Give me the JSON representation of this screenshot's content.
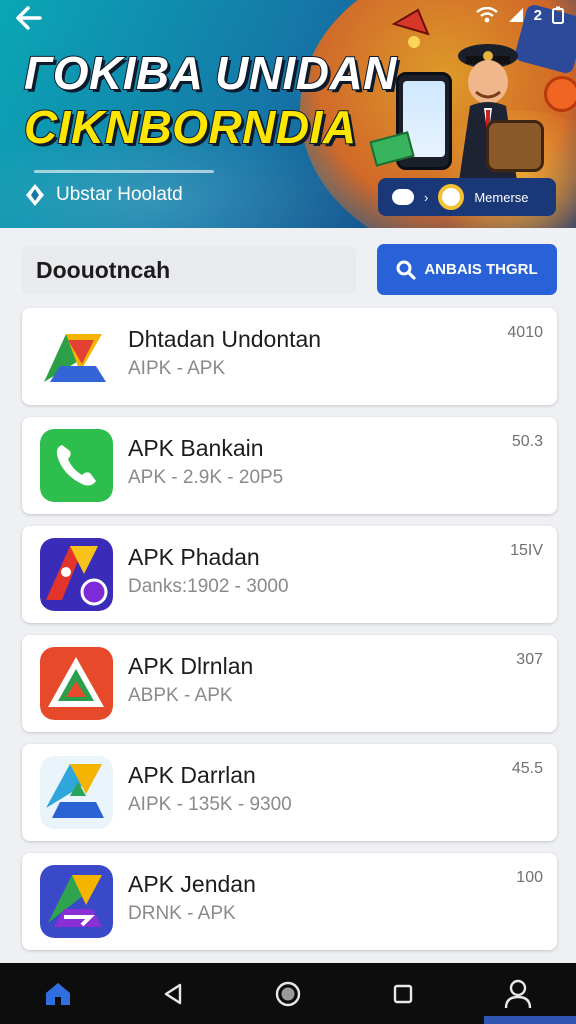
{
  "banner": {
    "title_line1": "ГOKIBA UNIDAN",
    "title_line2": "CIKNBORNDIA",
    "subtitle": "Ubstar Hoolatd",
    "pill_label": "Memerse",
    "pill_arrow": "›",
    "status": {
      "battery_text": "2"
    }
  },
  "section": {
    "title": "Doouotncah",
    "search_button_label": "ANBAIS THGRL"
  },
  "apps": [
    {
      "title": "Dhtadan Undontan",
      "meta": "AIPK - APK",
      "rating": "4010"
    },
    {
      "title": "APK Bankain",
      "meta": "APK - 2.9K - 20P5",
      "rating": "50.3"
    },
    {
      "title": "APK Phadan",
      "meta": "Danks:1902 - 3000",
      "rating": "15IV"
    },
    {
      "title": "APK Dlrnlan",
      "meta": "ABPK - APK",
      "rating": "307"
    },
    {
      "title": "APK Darrlan",
      "meta": "AIPK - 135K - 9300",
      "rating": "45.5"
    },
    {
      "title": "APK Jendan",
      "meta": "DRNK - APK",
      "rating": "100"
    }
  ],
  "colors": {
    "accent": "#2962d8",
    "title_yellow": "#ffe600",
    "nav_bg": "#0d0d0d"
  },
  "icons": [
    "back-arrow-icon",
    "wifi-icon",
    "signal-icon",
    "battery-icon",
    "search-icon",
    "home-icon",
    "back-triangle-icon",
    "home-circle-icon",
    "recents-square-icon",
    "profile-icon"
  ]
}
